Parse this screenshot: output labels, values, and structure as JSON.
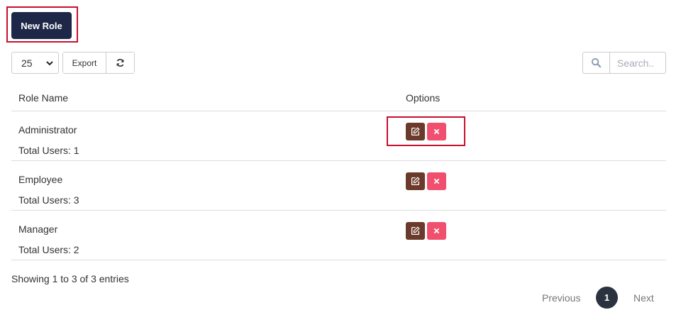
{
  "header": {
    "new_role_label": "New Role"
  },
  "toolbar": {
    "page_size": "25",
    "export_label": "Export",
    "refresh_icon": "refresh-icon"
  },
  "search": {
    "placeholder": "Search..",
    "icon": "search-icon"
  },
  "table": {
    "columns": [
      "Role Name",
      "Options"
    ],
    "rows": [
      {
        "name": "Administrator",
        "users": "Total Users: 1"
      },
      {
        "name": "Employee",
        "users": "Total Users: 3"
      },
      {
        "name": "Manager",
        "users": "Total Users: 2"
      }
    ]
  },
  "footer": {
    "info": "Showing 1 to 3 of 3 entries"
  },
  "pagination": {
    "previous": "Previous",
    "current": "1",
    "next": "Next"
  },
  "colors": {
    "primary": "#1e2747",
    "edit": "#6b3a2a",
    "delete": "#f0506e",
    "highlight": "#c8102e",
    "active_page": "#2b3340"
  }
}
